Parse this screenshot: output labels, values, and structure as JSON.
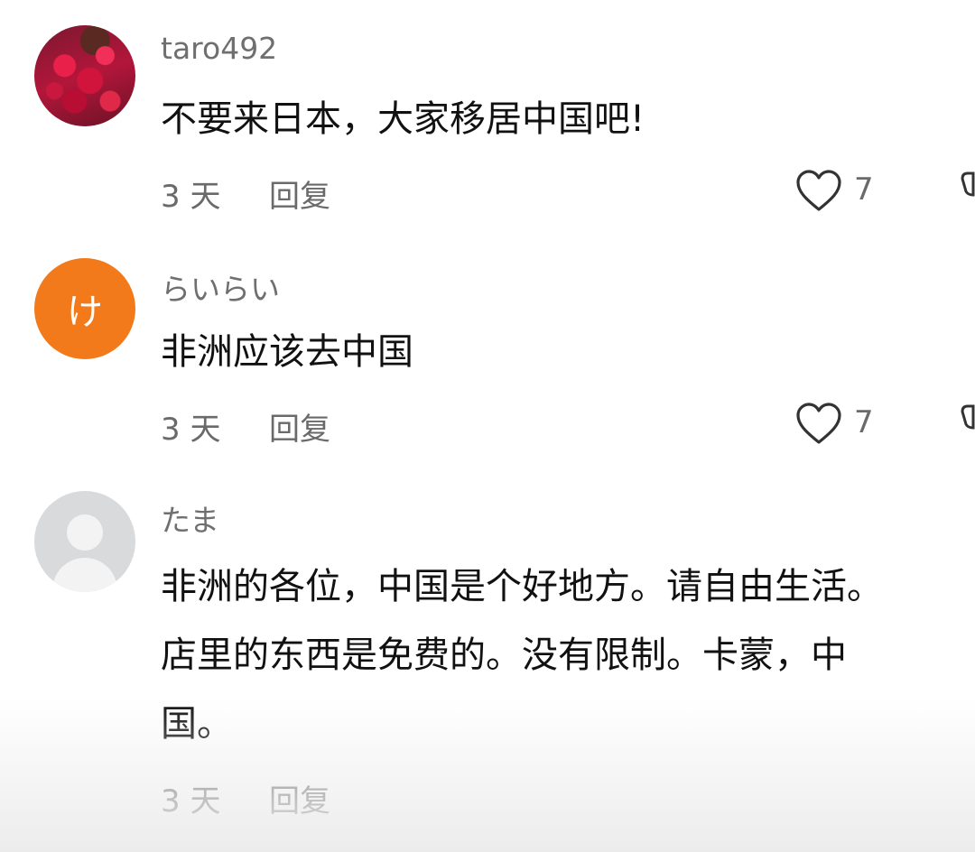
{
  "comments": [
    {
      "username": "taro492",
      "lines": [
        "不要来日本，大家移居中国吧!"
      ],
      "time": "3 天",
      "reply_label": "回复",
      "likes": "7",
      "avatar": {
        "type": "photo",
        "colors": [
          "#e8204a",
          "#b3163a",
          "#5a2a22"
        ]
      }
    },
    {
      "username": "らいらい",
      "lines": [
        "非洲应该去中国"
      ],
      "time": "3 天",
      "reply_label": "回复",
      "likes": "7",
      "avatar": {
        "type": "letter",
        "letter": "け",
        "color": "#f27a1a"
      }
    },
    {
      "username": "たま",
      "lines": [
        "非洲的各位，中国是个好地方。请自由生活。",
        "店里的东西是免费的。没有限制。卡蒙，中",
        "国。"
      ],
      "time": "3 天",
      "reply_label": "回复",
      "avatar": {
        "type": "default",
        "color": "#d9dadc"
      }
    }
  ],
  "icons": {
    "like": "heart-outline-icon",
    "dislike": "thumbs-down-outline-icon"
  }
}
